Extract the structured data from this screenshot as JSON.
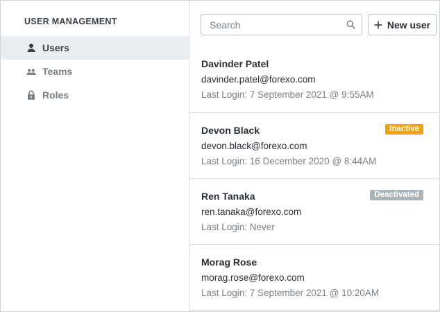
{
  "sidebar": {
    "title": "USER MANAGEMENT",
    "items": [
      {
        "label": "Users",
        "icon": "user-icon",
        "active": true
      },
      {
        "label": "Teams",
        "icon": "team-icon",
        "active": false
      },
      {
        "label": "Roles",
        "icon": "lock-icon",
        "active": false
      }
    ]
  },
  "toolbar": {
    "search_placeholder": "Search",
    "search_value": "",
    "new_user_label": "New user"
  },
  "users": [
    {
      "name": "Davinder Patel",
      "email": "davinder.patel@forexo.com",
      "last_login": "Last Login: 7 September 2021 @ 9:55AM",
      "badge": "",
      "badge_color": ""
    },
    {
      "name": "Devon Black",
      "email": "devon.black@forexo.com",
      "last_login": "Last Login: 16 December 2020 @ 8:44AM",
      "badge": "Inactive",
      "badge_color": "#f0a30a"
    },
    {
      "name": "Ren Tanaka",
      "email": "ren.tanaka@forexo.com",
      "last_login": "Last Login: Never",
      "badge": "Deactivated",
      "badge_color": "#a8b3ba"
    },
    {
      "name": "Morag Rose",
      "email": "morag.rose@forexo.com",
      "last_login": "Last Login: 7 September 2021 @ 10:20AM",
      "badge": "",
      "badge_color": ""
    }
  ],
  "colors": {
    "active_bg": "#ebeef0",
    "inactive_badge": "#f0a30a",
    "deactivated_badge": "#a8b3ba"
  }
}
